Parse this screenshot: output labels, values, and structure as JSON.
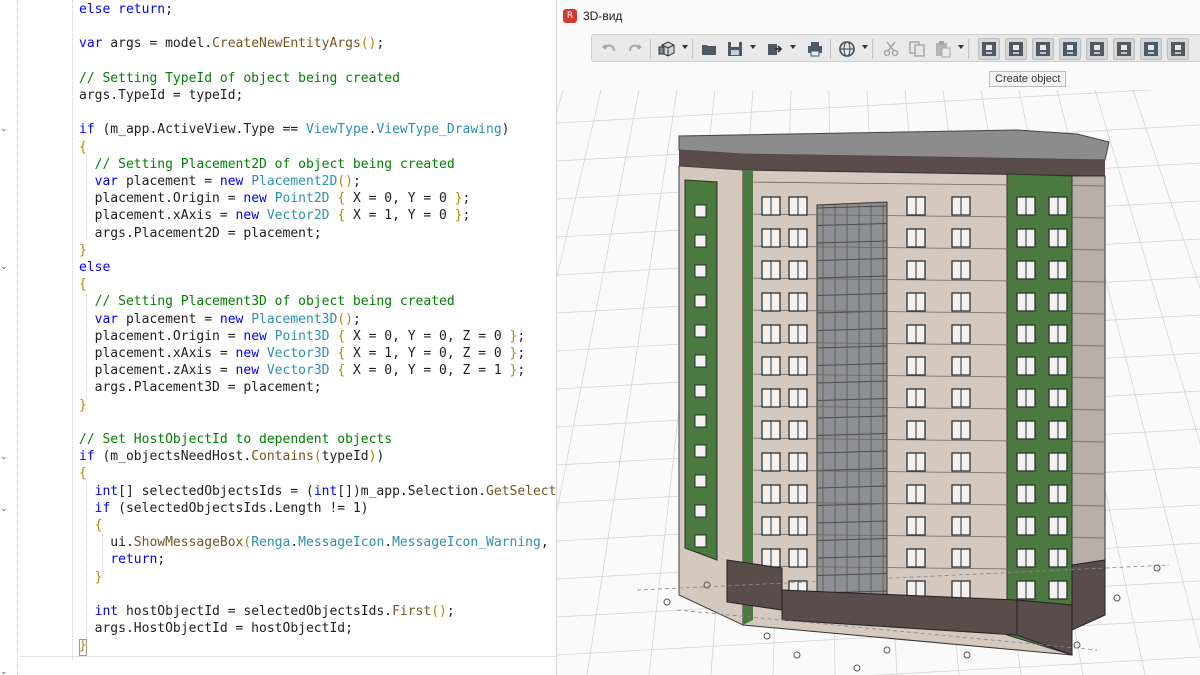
{
  "editor": {
    "lines": [
      [
        [
          "k",
          "else"
        ],
        [
          "b",
          " "
        ],
        [
          "k",
          "return"
        ],
        [
          "b",
          ";"
        ]
      ],
      [],
      [
        [
          "k",
          "var"
        ],
        [
          "b",
          " args = model."
        ],
        [
          "m",
          "CreateNewEntityArgs"
        ],
        [
          "y",
          "()"
        ],
        [
          "b",
          ";"
        ]
      ],
      [],
      [
        [
          "c",
          "// Setting TypeId of object being created"
        ]
      ],
      [
        [
          "b",
          "args.TypeId = typeId;"
        ]
      ],
      [],
      [
        [
          "k",
          "if"
        ],
        [
          "b",
          " (m_app.ActiveView.Type == "
        ],
        [
          "t",
          "ViewType"
        ],
        [
          "b",
          "."
        ],
        [
          "t",
          "ViewType_Drawing"
        ],
        [
          "b",
          ")"
        ]
      ],
      [
        [
          "y",
          "{"
        ]
      ],
      [
        [
          "b",
          "  "
        ],
        [
          "c",
          "// Setting Placement2D of object being created"
        ]
      ],
      [
        [
          "b",
          "  "
        ],
        [
          "k",
          "var"
        ],
        [
          "b",
          " placement = "
        ],
        [
          "k",
          "new"
        ],
        [
          "b",
          " "
        ],
        [
          "t",
          "Placement2D"
        ],
        [
          "y",
          "()"
        ],
        [
          "b",
          ";"
        ]
      ],
      [
        [
          "b",
          "  placement.Origin = "
        ],
        [
          "k",
          "new"
        ],
        [
          "b",
          " "
        ],
        [
          "t",
          "Point2D"
        ],
        [
          "b",
          " "
        ],
        [
          "y",
          "{"
        ],
        [
          "b",
          " X = 0, Y = 0 "
        ],
        [
          "y",
          "}"
        ],
        [
          "b",
          ";"
        ]
      ],
      [
        [
          "b",
          "  placement.xAxis = "
        ],
        [
          "k",
          "new"
        ],
        [
          "b",
          " "
        ],
        [
          "t",
          "Vector2D"
        ],
        [
          "b",
          " "
        ],
        [
          "y",
          "{"
        ],
        [
          "b",
          " X = 1, Y = 0 "
        ],
        [
          "y",
          "}"
        ],
        [
          "b",
          ";"
        ]
      ],
      [
        [
          "b",
          "  args.Placement2D = placement;"
        ]
      ],
      [
        [
          "y",
          "}"
        ]
      ],
      [
        [
          "k",
          "else"
        ]
      ],
      [
        [
          "y",
          "{"
        ]
      ],
      [
        [
          "b",
          "  "
        ],
        [
          "c",
          "// Setting Placement3D of object being created"
        ]
      ],
      [
        [
          "b",
          "  "
        ],
        [
          "k",
          "var"
        ],
        [
          "b",
          " placement = "
        ],
        [
          "k",
          "new"
        ],
        [
          "b",
          " "
        ],
        [
          "t",
          "Placement3D"
        ],
        [
          "y",
          "()"
        ],
        [
          "b",
          ";"
        ]
      ],
      [
        [
          "b",
          "  placement.Origin = "
        ],
        [
          "k",
          "new"
        ],
        [
          "b",
          " "
        ],
        [
          "t",
          "Point3D"
        ],
        [
          "b",
          " "
        ],
        [
          "y",
          "{"
        ],
        [
          "b",
          " X = 0, Y = 0, Z = 0 "
        ],
        [
          "y",
          "}"
        ],
        [
          "b",
          ";"
        ]
      ],
      [
        [
          "b",
          "  placement.xAxis = "
        ],
        [
          "k",
          "new"
        ],
        [
          "b",
          " "
        ],
        [
          "t",
          "Vector3D"
        ],
        [
          "b",
          " "
        ],
        [
          "y",
          "{"
        ],
        [
          "b",
          " X = 1, Y = 0, Z = 0 "
        ],
        [
          "y",
          "}"
        ],
        [
          "b",
          ";"
        ]
      ],
      [
        [
          "b",
          "  placement.zAxis = "
        ],
        [
          "k",
          "new"
        ],
        [
          "b",
          " "
        ],
        [
          "t",
          "Vector3D"
        ],
        [
          "b",
          " "
        ],
        [
          "y",
          "{"
        ],
        [
          "b",
          " X = 0, Y = 0, Z = 1 "
        ],
        [
          "y",
          "}"
        ],
        [
          "b",
          ";"
        ]
      ],
      [
        [
          "b",
          "  args.Placement3D = placement;"
        ]
      ],
      [
        [
          "y",
          "}"
        ]
      ],
      [],
      [
        [
          "c",
          "// Set HostObjectId to dependent objects"
        ]
      ],
      [
        [
          "k",
          "if"
        ],
        [
          "b",
          " (m_objectsNeedHost."
        ],
        [
          "m",
          "Contains"
        ],
        [
          "y",
          "("
        ],
        [
          "b",
          "typeId"
        ],
        [
          "y",
          ")"
        ],
        [
          "b",
          ")"
        ]
      ],
      [
        [
          "y",
          "{"
        ]
      ],
      [
        [
          "b",
          "  "
        ],
        [
          "k",
          "int"
        ],
        [
          "b",
          "[] selectedObjectsIds = ("
        ],
        [
          "k",
          "int"
        ],
        [
          "b",
          "[])m_app.Selection."
        ],
        [
          "m",
          "GetSelecte"
        ]
      ],
      [
        [
          "b",
          "  "
        ],
        [
          "k",
          "if"
        ],
        [
          "b",
          " (selectedObjectsIds.Length != 1)"
        ]
      ],
      [
        [
          "b",
          "  "
        ],
        [
          "y",
          "{"
        ]
      ],
      [
        [
          "b",
          "    ui."
        ],
        [
          "m",
          "ShowMessageBox"
        ],
        [
          "y",
          "("
        ],
        [
          "t",
          "Renga"
        ],
        [
          "b",
          "."
        ],
        [
          "t",
          "MessageIcon"
        ],
        [
          "b",
          "."
        ],
        [
          "t",
          "MessageIcon_Warning"
        ],
        [
          "b",
          ", ",
          ""
        ]
      ],
      [
        [
          "b",
          "    "
        ],
        [
          "k",
          "return"
        ],
        [
          "b",
          ";"
        ]
      ],
      [
        [
          "b",
          "  "
        ],
        [
          "y",
          "}"
        ]
      ],
      [],
      [
        [
          "b",
          "  "
        ],
        [
          "k",
          "int"
        ],
        [
          "b",
          " hostObjectId = selectedObjectsIds."
        ],
        [
          "m",
          "First"
        ],
        [
          "y",
          "()"
        ],
        [
          "b",
          ";"
        ]
      ],
      [
        [
          "b",
          "  args.HostObjectId = hostObjectId;"
        ]
      ],
      [
        [
          "y",
          "}"
        ]
      ]
    ],
    "fold_marks": [
      "⌄",
      "⌄",
      "⌄",
      "⌄",
      "⌄"
    ]
  },
  "viewer": {
    "app_icon_glyph": "R",
    "window_title": "3D-вид",
    "tooltip": "Create object",
    "toolbar": {
      "undo_icon": "undo-icon",
      "redo_icon": "redo-icon",
      "view_cube_icon": "view-cube-icon",
      "open_icon": "folder-icon",
      "save_icon": "save-icon",
      "export_icon": "export-icon",
      "print_icon": "print-icon",
      "orbit_icon": "orbit-icon",
      "cut_icon": "cut-icon",
      "copy_icon": "copy-icon",
      "paste_icon": "paste-icon",
      "command_icons": [
        "create-object-icon",
        "command-2-icon",
        "command-3-icon",
        "command-4-icon",
        "command-5-icon",
        "command-6-icon",
        "command-7-icon",
        "command-8-icon"
      ]
    },
    "colors": {
      "wall_light": "#d4c8bf",
      "wall_green": "#4a7a3f",
      "brick": "#5b4c4c",
      "grid": "#d4d4d4",
      "toolbar_bg": "#e9e9e9"
    }
  }
}
